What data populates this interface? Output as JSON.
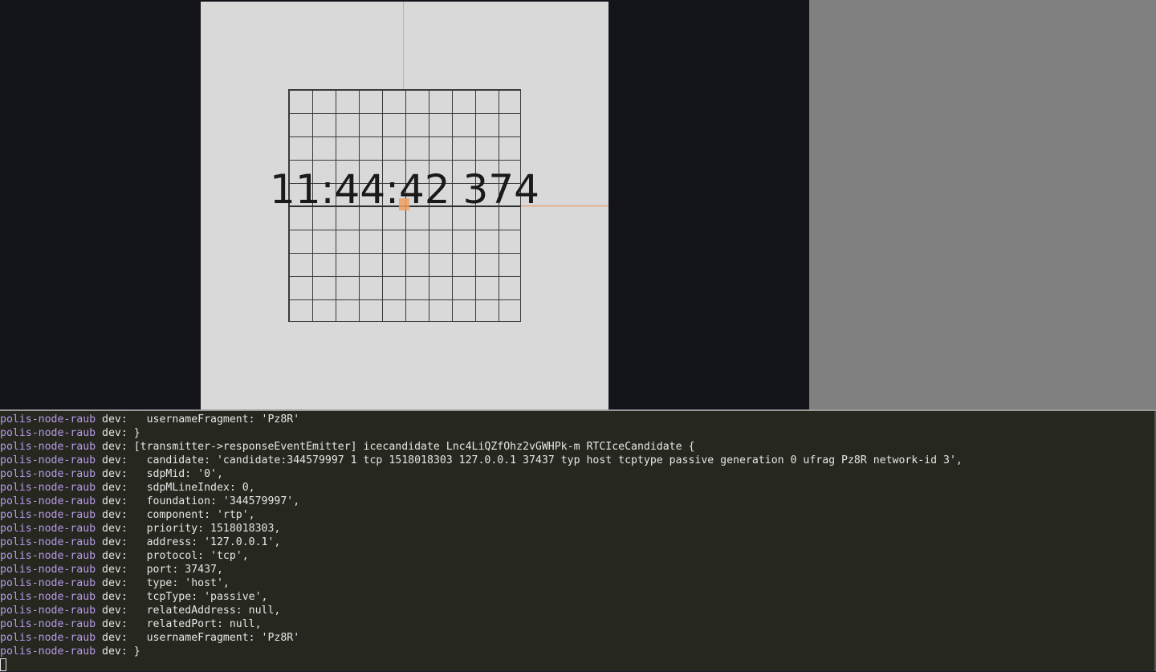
{
  "video": {
    "clock_text": "11:44:42 374",
    "colors": {
      "background": "#d9d9d9",
      "grid": "#3a3a3a",
      "green_guide": "#7fdc6a",
      "orange_guide": "#f08a4b"
    }
  },
  "terminal": {
    "prefix": "polis-node-raub",
    "env": "dev:",
    "lines": [
      "  usernameFragment: 'Pz8R'",
      "}",
      "[transmitter->responseEventEmitter] icecandidate Lnc4LiQZfOhz2vGWHPk-m RTCIceCandidate {",
      "  candidate: 'candidate:344579997 1 tcp 1518018303 127.0.0.1 37437 typ host tcptype passive generation 0 ufrag Pz8R network-id 3',",
      "  sdpMid: '0',",
      "  sdpMLineIndex: 0,",
      "  foundation: '344579997',",
      "  component: 'rtp',",
      "  priority: 1518018303,",
      "  address: '127.0.0.1',",
      "  protocol: 'tcp',",
      "  port: 37437,",
      "  type: 'host',",
      "  tcpType: 'passive',",
      "  relatedAddress: null,",
      "  relatedPort: null,",
      "  usernameFragment: 'Pz8R'",
      "}"
    ],
    "colors": {
      "prefix": "#b79ae8",
      "text": "#e6e6e6",
      "background": "#262820"
    }
  }
}
